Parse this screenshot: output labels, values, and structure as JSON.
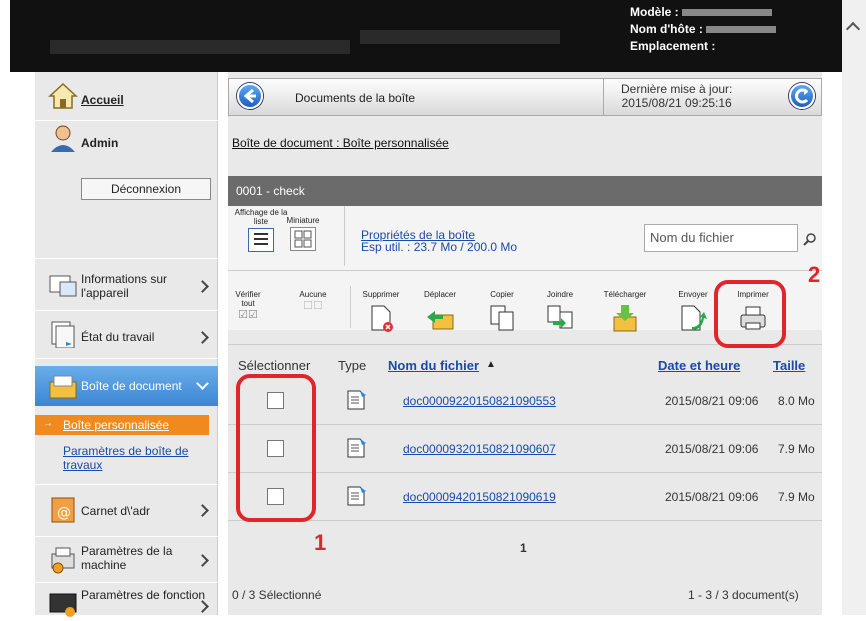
{
  "header": {
    "model_label": "Modèle :",
    "host_label": "Nom d'hôte :",
    "location_label": "Emplacement :"
  },
  "sidebar": {
    "home": "Accueil",
    "user": "Admin",
    "logout": "Déconnexion",
    "items": [
      {
        "label": "Informations sur l'appareil"
      },
      {
        "label": "État du travail"
      },
      {
        "label": "Boîte de document"
      },
      {
        "label": "Carnet d\\'adr"
      },
      {
        "label": "Paramètres de la machine"
      },
      {
        "label": "Paramètres de fonction"
      }
    ],
    "subitems": [
      "Boîte personnalisée",
      "Paramètres de boîte de travaux"
    ]
  },
  "main": {
    "title": "Documents de la boîte",
    "last_update_label": "Dernière mise à jour:",
    "last_update_value": "2015/08/21 09:25:16",
    "breadcrumb": "Boîte de document : Boîte personnalisée",
    "box_name": "0001 - check",
    "view_list": "Affichage de la liste",
    "view_thumb": "Miniature",
    "props_link": "Propriétés de la boîte",
    "space_used": "Esp util. : 23.7 Mo / 200.0 Mo",
    "search_placeholder": "Nom du fichier",
    "tools": [
      "Vérifier tout",
      "Aucune",
      "Supprimer",
      "Déplacer",
      "Copier",
      "Joindre",
      "Télécharger",
      "Envoyer",
      "Imprimer"
    ],
    "columns": {
      "select": "Sélectionner",
      "type": "Type",
      "filename": "Nom du fichier",
      "date": "Date et heure",
      "size": "Taille"
    },
    "rows": [
      {
        "file": "doc00009220150821090553",
        "date": "2015/08/21 09:06",
        "size": "8.0 Mo"
      },
      {
        "file": "doc00009320150821090607",
        "date": "2015/08/21 09:06",
        "size": "7.9 Mo"
      },
      {
        "file": "doc00009420150821090619",
        "date": "2015/08/21 09:06",
        "size": "7.9 Mo"
      }
    ],
    "page": "1",
    "selected": "0 / 3 Sélectionné",
    "count": "1 - 3 / 3 document(s)"
  },
  "callouts": {
    "one": "1",
    "two": "2"
  }
}
